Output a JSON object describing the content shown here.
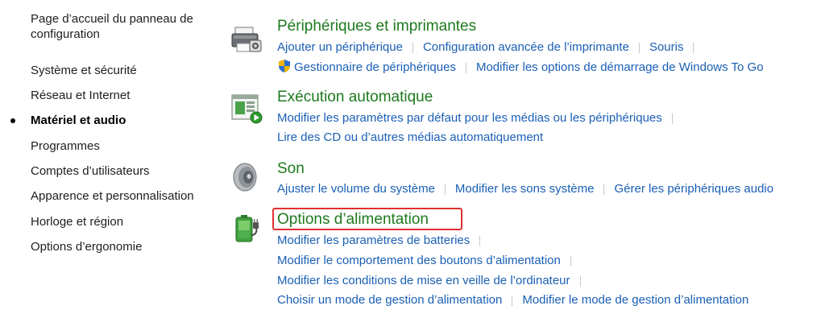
{
  "sidebar": {
    "items": [
      {
        "label": "Page d’accueil du panneau de configuration"
      },
      {
        "label": "Système et sécurité"
      },
      {
        "label": "Réseau et Internet"
      },
      {
        "label": "Matériel et audio"
      },
      {
        "label": "Programmes"
      },
      {
        "label": "Comptes d’utilisateurs"
      },
      {
        "label": "Apparence et personnalisation"
      },
      {
        "label": "Horloge et région"
      },
      {
        "label": "Options d’ergonomie"
      }
    ]
  },
  "sections": [
    {
      "title": "Périphériques et imprimantes",
      "icon": "printer-icon",
      "rows": [
        [
          "Ajouter un périphérique",
          "Configuration avancée de l’imprimante",
          "Souris"
        ],
        [
          "Gestionnaire de périphériques",
          "Modifier les options de démarrage de Windows To Go"
        ]
      ]
    },
    {
      "title": "Exécution automatique",
      "icon": "autoplay-icon",
      "rows": [
        [
          "Modifier les paramètres par défaut pour les médias ou les périphériques"
        ],
        [
          "Lire des CD ou d’autres médias automatiquement"
        ]
      ]
    },
    {
      "title": "Son",
      "icon": "speaker-icon",
      "rows": [
        [
          "Ajuster le volume du système",
          "Modifier les sons système",
          "Gérer les périphériques audio"
        ]
      ]
    },
    {
      "title": "Options d’alimentation",
      "icon": "power-battery-icon",
      "rows": [
        [
          "Modifier les paramètres de batteries"
        ],
        [
          "Modifier le comportement des boutons d’alimentation"
        ],
        [
          "Modifier les conditions de mise en veille de l’ordinateur"
        ],
        [
          "Choisir un mode de gestion d’alimentation",
          "Modifier le mode de gestion d’alimentation"
        ]
      ]
    }
  ],
  "colors": {
    "section_title": "#1e7a1e",
    "link": "#1a5fb4",
    "highlight_box": "#e03030"
  }
}
